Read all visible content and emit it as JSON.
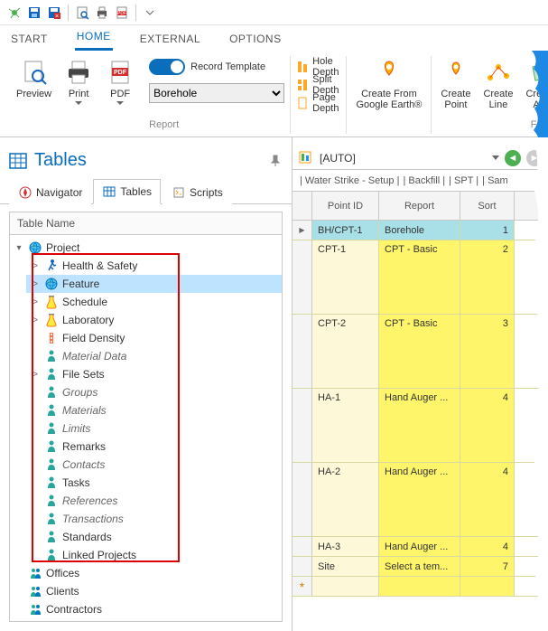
{
  "qat_icons": [
    "app-icon",
    "save-icon",
    "save-close-icon",
    "sep",
    "search-icon",
    "print-icon",
    "pdf-icon",
    "sep",
    "dropdown-icon"
  ],
  "ribbon_tabs": [
    {
      "label": "START",
      "active": false
    },
    {
      "label": "HOME",
      "active": true
    },
    {
      "label": "EXTERNAL",
      "active": false
    },
    {
      "label": "OPTIONS",
      "active": false
    }
  ],
  "ribbon": {
    "preview": "Preview",
    "print": "Print",
    "pdf": "PDF",
    "record_template": "Record Template",
    "report_select": "Borehole",
    "report_group": "Report",
    "depth_items": [
      "Hole Depth",
      "Split Depth",
      "Page Depth"
    ],
    "create_from": "Create From\nGoogle Earth®",
    "create_point": "Create\nPoint",
    "create_line": "Create\nLine",
    "create_area": "Create\nAre",
    "feature_group": "Featur"
  },
  "tables_panel": {
    "title": "Tables",
    "inner_tabs": [
      {
        "label": "Navigator",
        "icon": "compass"
      },
      {
        "label": "Tables",
        "icon": "table",
        "active": true
      },
      {
        "label": "Scripts",
        "icon": "script"
      }
    ],
    "col_header": "Table Name",
    "tree": {
      "root": {
        "label": "Project",
        "icon": "globe",
        "expanded": true
      },
      "children": [
        {
          "label": "Health & Safety",
          "icon": "person-run",
          "exp": ">"
        },
        {
          "label": "Feature",
          "icon": "globe",
          "exp": ">",
          "selected": true
        },
        {
          "label": "Schedule",
          "icon": "flask",
          "exp": ">"
        },
        {
          "label": "Laboratory",
          "icon": "flask",
          "exp": ">"
        },
        {
          "label": "Field Density",
          "icon": "density",
          "exp": ""
        },
        {
          "label": "Material Data",
          "icon": "person",
          "exp": "",
          "italic": true
        },
        {
          "label": "File Sets",
          "icon": "person",
          "exp": ">"
        },
        {
          "label": "Groups",
          "icon": "person",
          "exp": "",
          "italic": true
        },
        {
          "label": "Materials",
          "icon": "person",
          "exp": "",
          "italic": true
        },
        {
          "label": "Limits",
          "icon": "person",
          "exp": "",
          "italic": true
        },
        {
          "label": "Remarks",
          "icon": "person",
          "exp": ""
        },
        {
          "label": "Contacts",
          "icon": "person",
          "exp": "",
          "italic": true
        },
        {
          "label": "Tasks",
          "icon": "person",
          "exp": ""
        },
        {
          "label": "References",
          "icon": "person",
          "exp": "",
          "italic": true
        },
        {
          "label": "Transactions",
          "icon": "person",
          "exp": "",
          "italic": true
        },
        {
          "label": "Standards",
          "icon": "person",
          "exp": ""
        },
        {
          "label": "Linked Projects",
          "icon": "person",
          "exp": ""
        }
      ],
      "after": [
        {
          "label": "Offices",
          "icon": "people"
        },
        {
          "label": "Clients",
          "icon": "people"
        },
        {
          "label": "Contractors",
          "icon": "people"
        }
      ]
    }
  },
  "right": {
    "auto": "[AUTO]",
    "crumbs": [
      "| Water Strike - Setup |",
      "| Backfill |",
      "| SPT |",
      "| Sam"
    ],
    "grid_headers": [
      "Point ID",
      "Report",
      "Sort"
    ],
    "rows": [
      {
        "pid": "BH/CPT-1",
        "rep": "Borehole",
        "sort": "1",
        "sel": true,
        "h": "short"
      },
      {
        "pid": "CPT-1",
        "rep": "CPT - Basic",
        "sort": "2",
        "h": "tall"
      },
      {
        "pid": "CPT-2",
        "rep": "CPT - Basic",
        "sort": "3",
        "h": "tall"
      },
      {
        "pid": "HA-1",
        "rep": "Hand Auger ...",
        "sort": "4",
        "h": "tall"
      },
      {
        "pid": "HA-2",
        "rep": "Hand Auger ...",
        "sort": "4",
        "h": "tall"
      },
      {
        "pid": "HA-3",
        "rep": "Hand Auger ...",
        "sort": "4",
        "h": "short"
      },
      {
        "pid": "Site",
        "rep": "Select a tem...",
        "sort": "7",
        "h": "short"
      },
      {
        "pid": "",
        "rep": "",
        "sort": "",
        "new": true,
        "h": "short"
      }
    ]
  }
}
